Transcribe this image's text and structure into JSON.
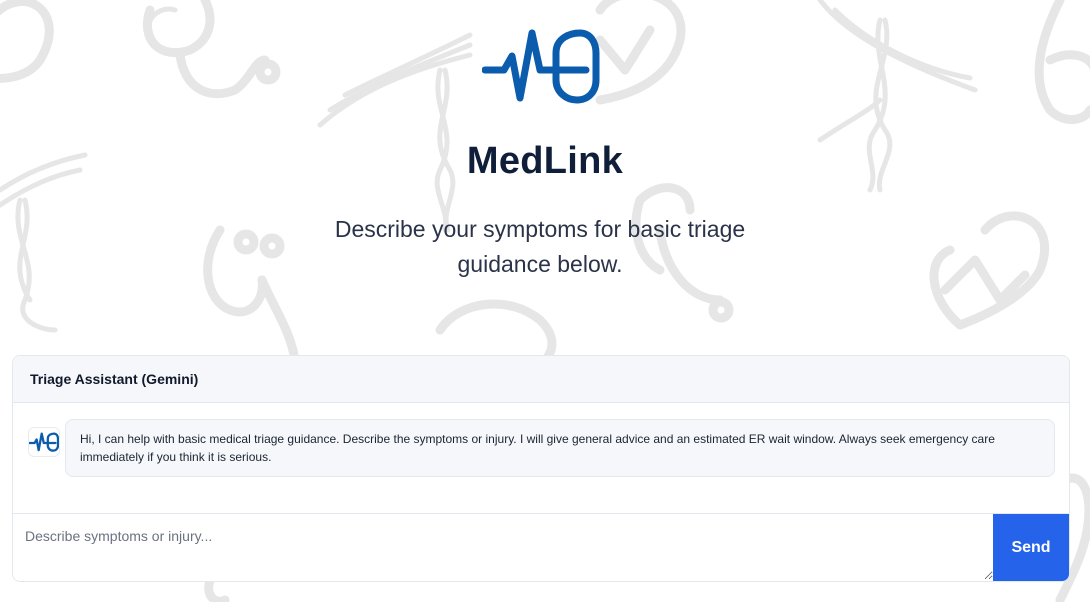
{
  "app": {
    "title": "MedLink",
    "subtitle": "Describe your symptoms for basic triage guidance below.",
    "logo_icon": "heartbeat-pulse-icon",
    "accent_color": "#0b5cad"
  },
  "chat": {
    "header_title": "Triage Assistant (Gemini)",
    "messages": [
      {
        "role": "assistant",
        "avatar_icon": "medlink-logo-icon",
        "text": "Hi, I can help with basic medical triage guidance. Describe the symptoms or injury. I will give general advice and an estimated ER wait window. Always seek emergency care immediately if you think it is serious."
      }
    ],
    "input": {
      "value": "",
      "placeholder": "Describe symptoms or injury..."
    },
    "send_label": "Send",
    "send_color": "#2563eb"
  },
  "background": {
    "icons": [
      "stethoscope-icon",
      "caduceus-icon",
      "heart-pulse-icon"
    ],
    "color": "#e6e6e6"
  }
}
